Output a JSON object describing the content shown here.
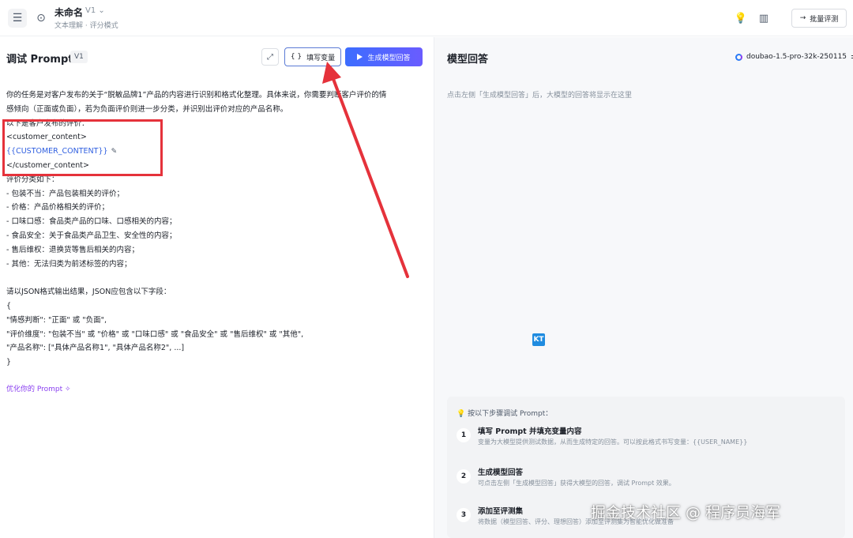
{
  "topbar": {
    "title": "未命名",
    "version": "V1 ⌄",
    "subtitle": "文本理解 · 评分模式",
    "batch_label": "批量评测"
  },
  "left": {
    "title": "调试 Prompt",
    "version_badge": "V1",
    "fill_vars_label": "填写变量",
    "generate_label": "生成模型回答",
    "prompt_lines": [
      "你的任务是对客户发布的关于“脱敏品牌1”产品的内容进行识别和格式化整理。具体来说，你需要判断客户评价的情",
      "感倾向（正面或负面），若为负面评价则进一步分类，并识别出评价对应的产品名称。",
      "以下是客户发布的评价：",
      "<customer_content>",
      "{{CUSTOMER_CONTENT}}",
      "</customer_content>",
      "评价分类如下：",
      "- 包装不当：产品包装相关的评价；",
      "- 价格：产品价格相关的评价；",
      "- 口味口感：食品类产品的口味、口感相关的内容；",
      "- 食品安全：关于食品类产品卫生、安全性的内容；",
      "- 售后维权：退换货等售后相关的内容；",
      "- 其他：无法归类为前述标签的内容；",
      "",
      "请以JSON格式输出结果，JSON应包含以下字段：",
      "{",
      "  \"情感判断\": \"正面\" 或 \"负面\",",
      "  \"评价维度\": \"包装不当\" 或 \"价格\" 或 \"口味口感\" 或 \"食品安全\" 或 \"售后维权\" 或 \"其他\",",
      "  \"产品名称\": [\"具体产品名称1\", \"具体产品名称2\", ...]",
      "}"
    ],
    "optimize_label": "优化你的 Prompt"
  },
  "right": {
    "title": "模型回答",
    "model_name": "doubao-1.5-pro-32k-250115",
    "placeholder": "点击左侧「生成模型回答」后，大模型的回答将显示在这里",
    "kt_badge": "KT",
    "steps_head": "按以下步骤调试 Prompt：",
    "steps": [
      {
        "num": "1",
        "title": "填写 Prompt 并填充变量内容",
        "desc": "变量为大模型提供测试数据，从而生成特定的回答。可以按此格式书写变量：{{USER_NAME}}"
      },
      {
        "num": "2",
        "title": "生成模型回答",
        "desc": "可点击左侧「生成模型回答」获得大模型的回答，调试 Prompt 效果。"
      },
      {
        "num": "3",
        "title": "添加至评测集",
        "desc": "将数据（模型回答、评分、理想回答）添加至评测集为智能优化做准备"
      }
    ]
  },
  "watermark": "掘金技术社区 @ 程序员海军",
  "colors": {
    "accent": "#3c6dff",
    "annotation_red": "#e5323b",
    "variable_blue": "#2f5fe0",
    "optimize_purple": "#8a3ff0"
  }
}
